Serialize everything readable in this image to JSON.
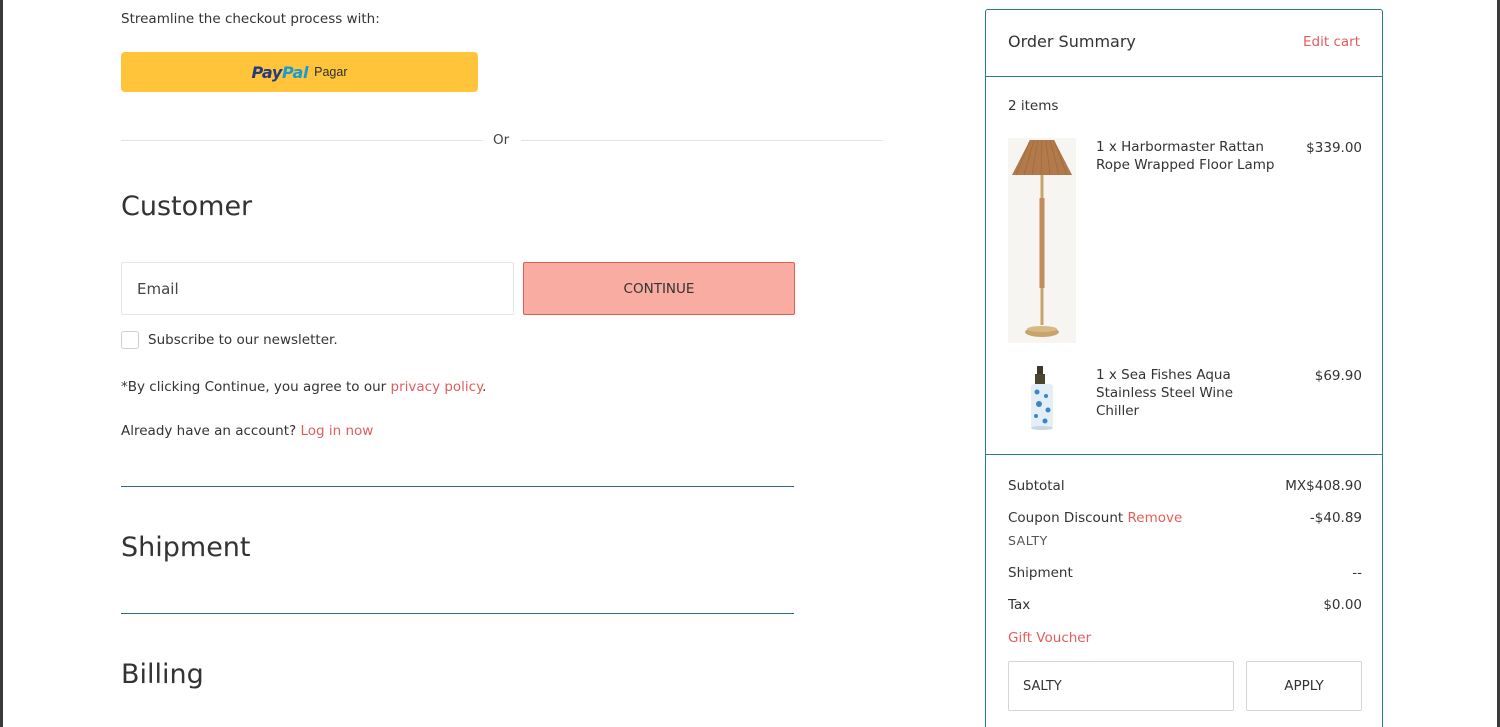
{
  "checkout": {
    "streamline_text": "Streamline the checkout process with:",
    "paypal": {
      "logo_pay": "Pay",
      "logo_pal": "Pal",
      "label": "Pagar"
    },
    "or_text": "Or"
  },
  "customer": {
    "heading": "Customer",
    "email_placeholder": "Email",
    "continue_label": "CONTINUE",
    "newsletter_label": "Subscribe to our newsletter.",
    "agree_text": "*By clicking Continue, you agree to our ",
    "privacy_link": "privacy policy",
    "agree_suffix": ".",
    "account_text": "Already have an account? ",
    "login_link": "Log in now"
  },
  "sections": {
    "shipment": "Shipment",
    "billing": "Billing"
  },
  "summary": {
    "title": "Order Summary",
    "edit_cart": "Edit cart",
    "items_count": "2 items",
    "items": [
      {
        "name": "1 x Harbormaster Rattan Rope Wrapped Floor Lamp",
        "price": "$339.00",
        "icon": "floor-lamp-image"
      },
      {
        "name": "1 x Sea Fishes Aqua Stainless Steel Wine Chiller",
        "price": "$69.90",
        "icon": "wine-chiller-image"
      }
    ],
    "subtotal_label": "Subtotal",
    "subtotal_value": "MX$408.90",
    "coupon_label": "Coupon Discount",
    "coupon_remove": "Remove",
    "coupon_value": "-$40.89",
    "coupon_code": "SALTY",
    "shipment_label": "Shipment",
    "shipment_value": "--",
    "tax_label": "Tax",
    "tax_value": "$0.00",
    "gift_voucher": "Gift Voucher",
    "voucher_value": "SALTY",
    "apply_label": "APPLY"
  },
  "colors": {
    "accent": "#e35d5d",
    "continue_bg": "#f9aca1",
    "paypal_bg": "#ffc439",
    "border_teal": "#2a7e8c"
  }
}
